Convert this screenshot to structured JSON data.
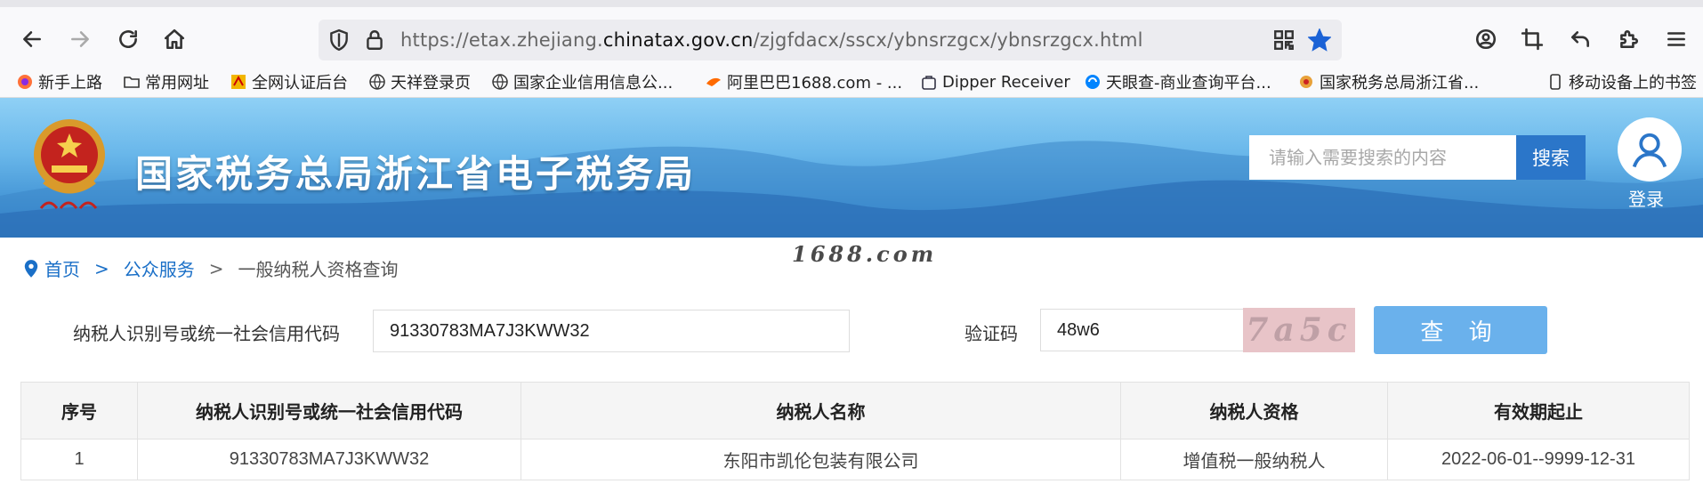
{
  "browser": {
    "url_prefix": "https://etax.zhejiang.",
    "url_domain": "chinatax.gov.cn",
    "url_path": "/zjgfdacx/sscx/ybnsrzgcx/ybnsrzgcx.html"
  },
  "bookmarks": [
    {
      "label": "新手上路",
      "icon": "firefox-icon"
    },
    {
      "label": "常用网址",
      "icon": "folder-icon"
    },
    {
      "label": "全网认证后台",
      "icon": "site-icon"
    },
    {
      "label": "天祥登录页",
      "icon": "globe-icon"
    },
    {
      "label": "国家企业信用信息公...",
      "icon": "globe-icon"
    },
    {
      "label": "阿里巴巴1688.com - ...",
      "icon": "alibaba-icon"
    },
    {
      "label": "Dipper Receiver",
      "icon": "bag-icon"
    },
    {
      "label": "天眼查-商业查询平台...",
      "icon": "tianyancha-icon"
    },
    {
      "label": "国家税务总局浙江省...",
      "icon": "tax-icon"
    },
    {
      "label": "移动设备上的书签",
      "icon": "mobile-icon"
    }
  ],
  "header": {
    "site_title": "国家税务总局浙江省电子税务局",
    "search_placeholder": "请输入需要搜索的内容",
    "search_button": "搜索",
    "login_label": "登录"
  },
  "breadcrumb": {
    "home": "首页",
    "sep": ">",
    "section": "公众服务",
    "current": "一般纳税人资格查询"
  },
  "watermark": "1688.com",
  "form": {
    "taxid_label": "纳税人识别号或统一社会信用代码",
    "taxid_value": "91330783MA7J3KWW32",
    "captcha_label": "验证码",
    "captcha_value": "48w6",
    "captcha_image_text": "7a5c",
    "query_button": "查 询"
  },
  "table": {
    "headers": [
      "序号",
      "纳税人识别号或统一社会信用代码",
      "纳税人名称",
      "纳税人资格",
      "有效期起止"
    ],
    "rows": [
      [
        "1",
        "91330783MA7J3KWW32",
        "东阳市凯伦包装有限公司",
        "增值税一般纳税人",
        "2022-06-01--9999-12-31"
      ]
    ]
  },
  "colors": {
    "link": "#1a6fc7",
    "search_button": "#2b76c9",
    "query_button": "#6ab1ec",
    "bookmark_star": "#1b62d6"
  }
}
